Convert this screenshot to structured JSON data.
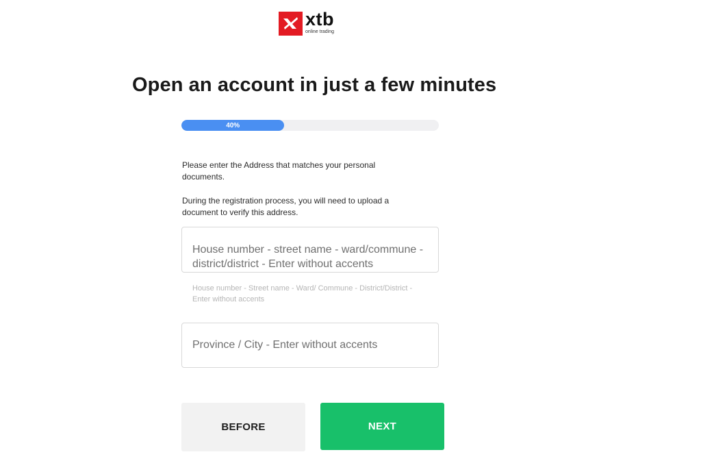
{
  "brand": {
    "name": "xtb",
    "tagline": "online trading",
    "color": "#e31b23"
  },
  "page": {
    "title": "Open an account in just a few minutes"
  },
  "progress": {
    "percent": 40,
    "label": "40%",
    "color": "#4a8ff2"
  },
  "instructions": {
    "line1": "Please enter the Address that matches your personal documents.",
    "line2": "During the registration process, you will need to upload a document to verify this address."
  },
  "form": {
    "address": {
      "placeholder": "House number - street name - ward/commune - district/district - Enter without accents",
      "value": "",
      "helper": "House number - Street name - Ward/ Commune - District/District - Enter without accents"
    },
    "city": {
      "placeholder": "Province / City - Enter without accents",
      "value": ""
    }
  },
  "buttons": {
    "before": "BEFORE",
    "next": "NEXT",
    "next_color": "#18c06a"
  }
}
